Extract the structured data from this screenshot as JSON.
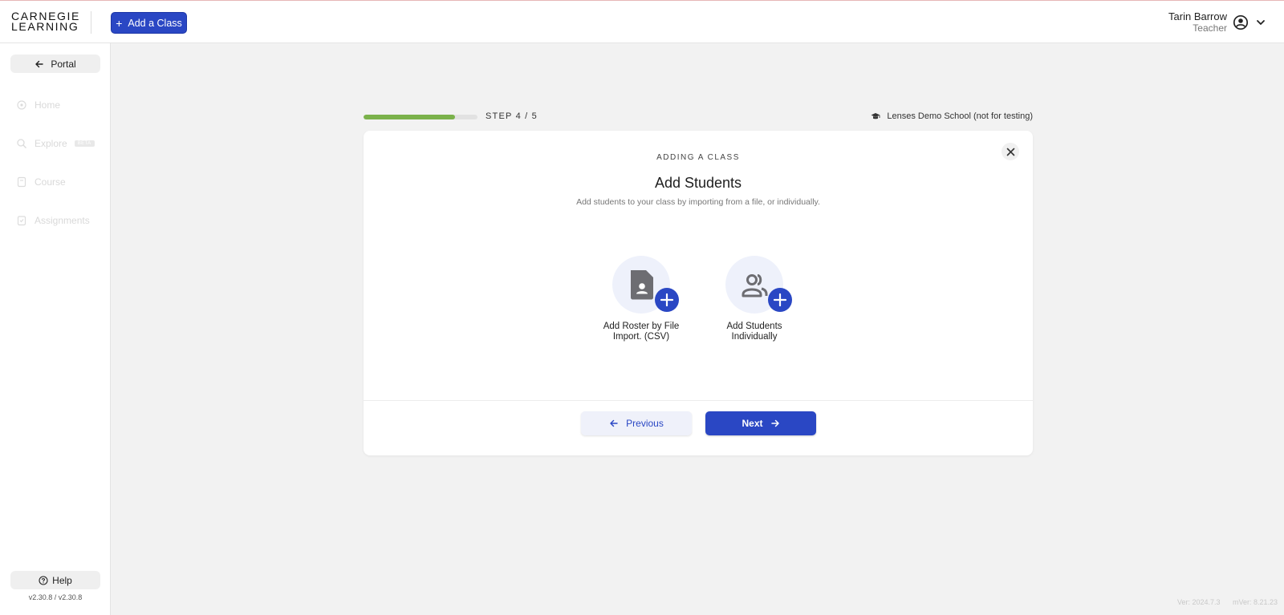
{
  "logo": {
    "line1": "CARNEGIE",
    "line2": "LEARNING"
  },
  "header": {
    "add_class_label": "Add a Class",
    "user_name": "Tarin Barrow",
    "user_role": "Teacher"
  },
  "sidebar": {
    "portal_label": "Portal",
    "items": [
      {
        "label": "Home",
        "icon": "home-icon"
      },
      {
        "label": "Explore",
        "icon": "search-icon",
        "badge": "BETA"
      },
      {
        "label": "Course",
        "icon": "course-icon"
      },
      {
        "label": "Assignments",
        "icon": "assignments-icon"
      }
    ],
    "help_label": "Help",
    "version": "v2.30.8 / v2.30.8"
  },
  "progress": {
    "fraction": 0.8,
    "step_label": "STEP 4 / 5",
    "school": "Lenses Demo School (not for testing)"
  },
  "card": {
    "eyebrow": "ADDING A CLASS",
    "title": "Add Students",
    "subtitle": "Add students to your class by importing from a file, or individually.",
    "options": [
      {
        "line1": "Add Roster by File",
        "line2": "Import. (CSV)",
        "icon": "file-person-icon"
      },
      {
        "line1": "Add Students",
        "line2": "Individually",
        "icon": "people-icon"
      }
    ],
    "previous_label": "Previous",
    "next_label": "Next"
  },
  "footer": {
    "ver": "Ver: 2024.7.3",
    "mver": "mVer: 8.21.23"
  },
  "colors": {
    "primary": "#2a47c4",
    "progress": "#7bb24b",
    "background": "#f2f2f2"
  }
}
